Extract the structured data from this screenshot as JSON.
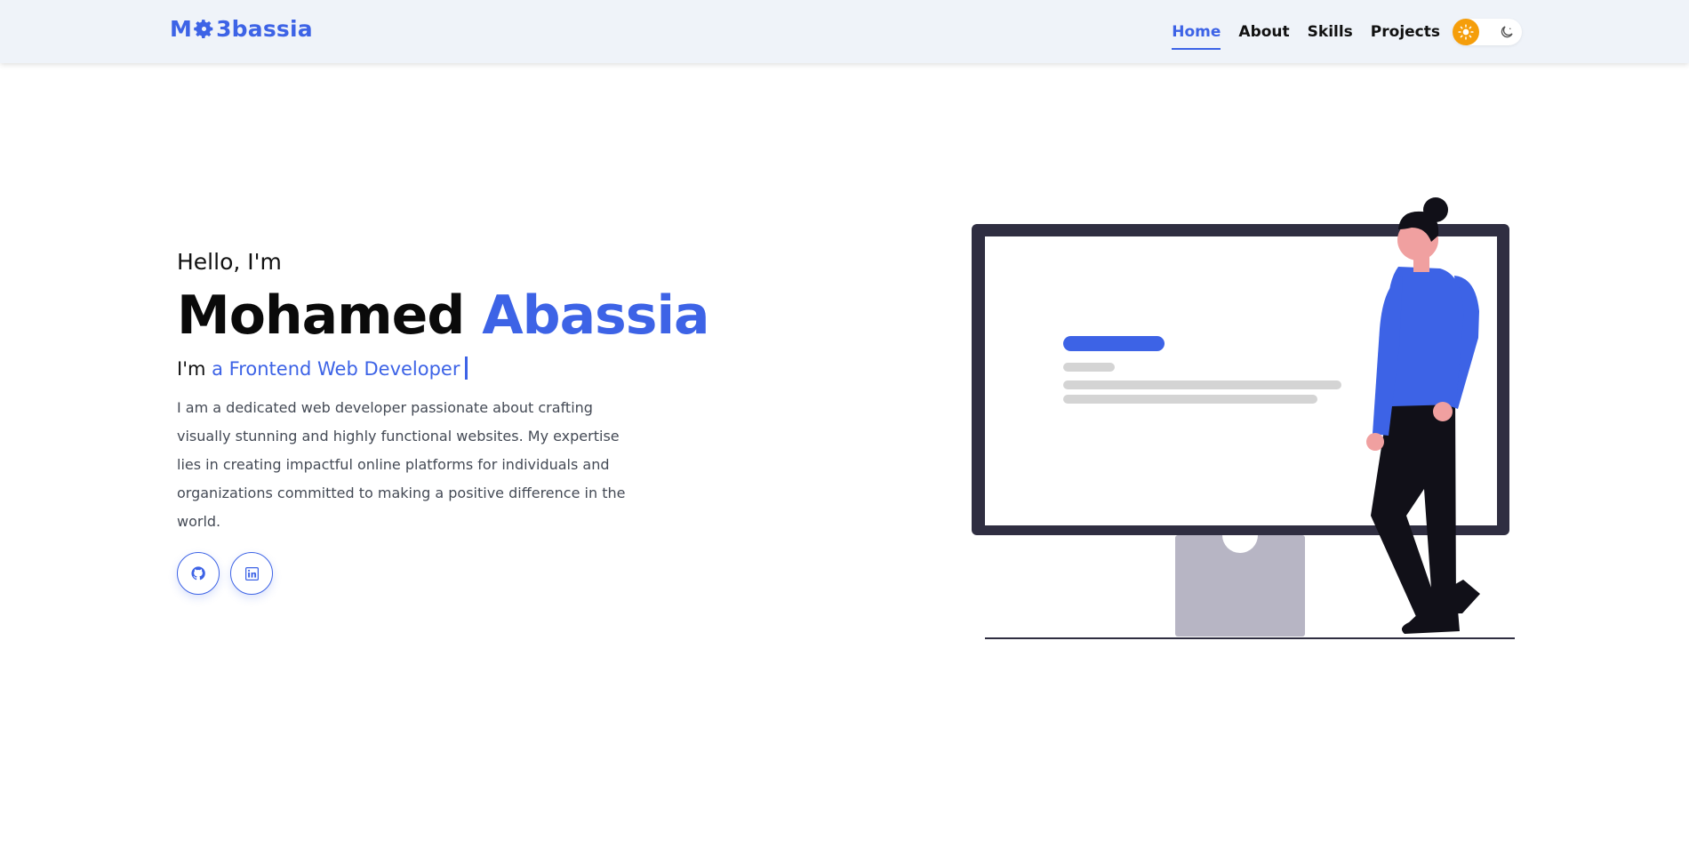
{
  "header": {
    "logo": {
      "prefix": "M",
      "suffix": "3bassia",
      "icon": "gear-icon"
    },
    "nav": [
      {
        "label": "Home",
        "active": true
      },
      {
        "label": "About",
        "active": false
      },
      {
        "label": "Skills",
        "active": false
      },
      {
        "label": "Projects",
        "active": false
      }
    ],
    "theme_toggle": {
      "light_icon": "sun-icon",
      "dark_icon": "moon-icon"
    }
  },
  "hero": {
    "greeting": "Hello, I'm",
    "first_name": "Mohamed",
    "last_name": "Abassia",
    "role_prefix": "I'm",
    "role": "a Frontend Web Developer",
    "bio": "I am a dedicated web developer passionate about crafting visually stunning and highly functional websites. My expertise lies in creating impactful online platforms for individuals and organizations committed to making a positive difference in the world.",
    "socials": [
      {
        "icon": "github-icon"
      },
      {
        "icon": "linkedin-icon"
      }
    ]
  },
  "colors": {
    "accent": "#3d63e6",
    "header_bg": "#eff3f9",
    "sun": "#f59e0b",
    "monitor_frame": "#2f2e41",
    "monitor_stand": "#b7b5c4"
  }
}
